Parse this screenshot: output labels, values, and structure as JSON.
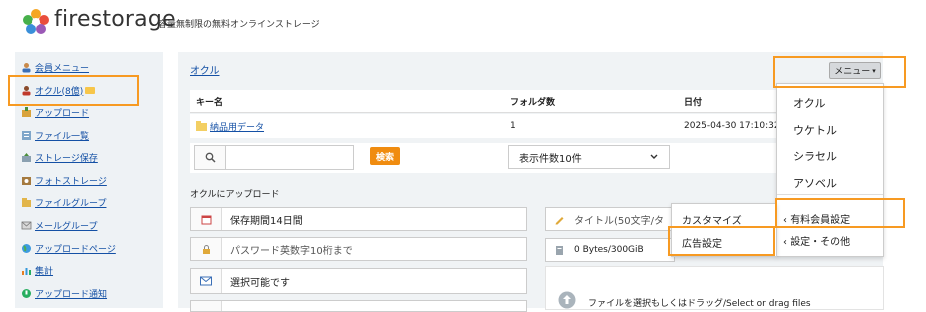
{
  "header": {
    "brand": "firestorage",
    "tagline": "容量無制限の無料オンラインストレージ",
    "logo_icon": "flower-logo-icon"
  },
  "sidebar": {
    "items": [
      {
        "label": "会員メニュー",
        "icon": "member-icon"
      },
      {
        "label": "オクル(8億)",
        "icon": "user-send-icon"
      },
      {
        "label": "アップロード",
        "icon": "upload-icon"
      },
      {
        "label": "ファイル一覧",
        "icon": "file-list-icon"
      },
      {
        "label": "ストレージ保存",
        "icon": "storage-icon"
      },
      {
        "label": "フォトストレージ",
        "icon": "photo-icon"
      },
      {
        "label": "ファイルグループ",
        "icon": "file-group-icon"
      },
      {
        "label": "メールグループ",
        "icon": "mail-group-icon"
      },
      {
        "label": "アップロードページ",
        "icon": "globe-icon"
      },
      {
        "label": "集計",
        "icon": "stats-icon"
      },
      {
        "label": "アップロード通知",
        "icon": "notify-icon"
      }
    ]
  },
  "main": {
    "breadcrumb": "オクル",
    "menu_button": "メニュー",
    "table": {
      "headers": [
        "キー名",
        "フォルダ数",
        "日付"
      ],
      "rows": [
        {
          "name": "納品用データ",
          "folders": "1",
          "date": "2025-04-30 17:10:32"
        }
      ]
    },
    "search_button": "検索",
    "per_page": "表示件数10件",
    "upload_title": "オクルにアップロード",
    "fields": {
      "retention": "保存期間14日間",
      "password_placeholder": "パスワード英数字10桁まで",
      "mail": "選択可能です",
      "title_placeholder": "タイトル(50文字/タ",
      "size": "0 Bytes/300GiB"
    },
    "drop_text": "ファイルを選択もしくはドラッグ/Select or drag files"
  },
  "dropdown": {
    "items": [
      "オクル",
      "ウケトル",
      "シラセル",
      "アソベル"
    ],
    "sub_items": [
      "有料会員設定",
      "設定・その他"
    ]
  },
  "submenu": {
    "items": [
      "カスタマイズ",
      "広告設定"
    ]
  },
  "colors": {
    "accent": "#f08c10",
    "link": "#1450a5",
    "highlight": "#f79a22"
  }
}
